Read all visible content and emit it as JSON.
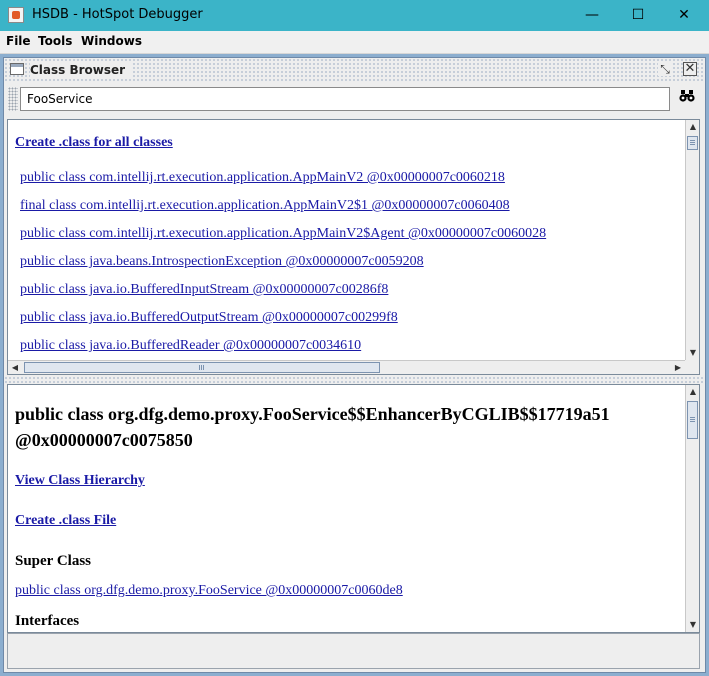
{
  "window": {
    "title": "HSDB - HotSpot Debugger",
    "minimize_glyph": "—",
    "maximize_glyph": "☐",
    "close_glyph": "✕"
  },
  "menu": {
    "file": "File",
    "tools": "Tools",
    "windows": "Windows"
  },
  "frame": {
    "title": "Class Browser",
    "restore_glyph": "⤡",
    "close_glyph": "✕"
  },
  "search": {
    "value": "FooService",
    "button_icon": "binoculars-icon",
    "button_glyph": "👓"
  },
  "class_list": {
    "create_all_label": "Create .class for all classes",
    "items": [
      "public class com.intellij.rt.execution.application.AppMainV2 @0x00000007c0060218",
      "final class com.intellij.rt.execution.application.AppMainV2$1 @0x00000007c0060408",
      "public class com.intellij.rt.execution.application.AppMainV2$Agent @0x00000007c0060028",
      "public class java.beans.IntrospectionException @0x00000007c0059208",
      "public class java.io.BufferedInputStream @0x00000007c00286f8",
      "public class java.io.BufferedOutputStream @0x00000007c00299f8",
      "public class java.io.BufferedReader @0x00000007c0034610"
    ]
  },
  "details": {
    "class_heading": "public class org.dfg.demo.proxy.FooService$$EnhancerByCGLIB$$17719a51 @0x00000007c0075850",
    "view_hierarchy": "View Class Hierarchy",
    "create_class_file": "Create .class File",
    "super_class_label": "Super Class",
    "super_class_link": "public class org.dfg.demo.proxy.FooService @0x00000007c0060de8",
    "interfaces_label": "Interfaces"
  },
  "colors": {
    "titlebar": "#3bb4c8",
    "link": "#1a1aa6",
    "desktop": "#8caecf"
  }
}
